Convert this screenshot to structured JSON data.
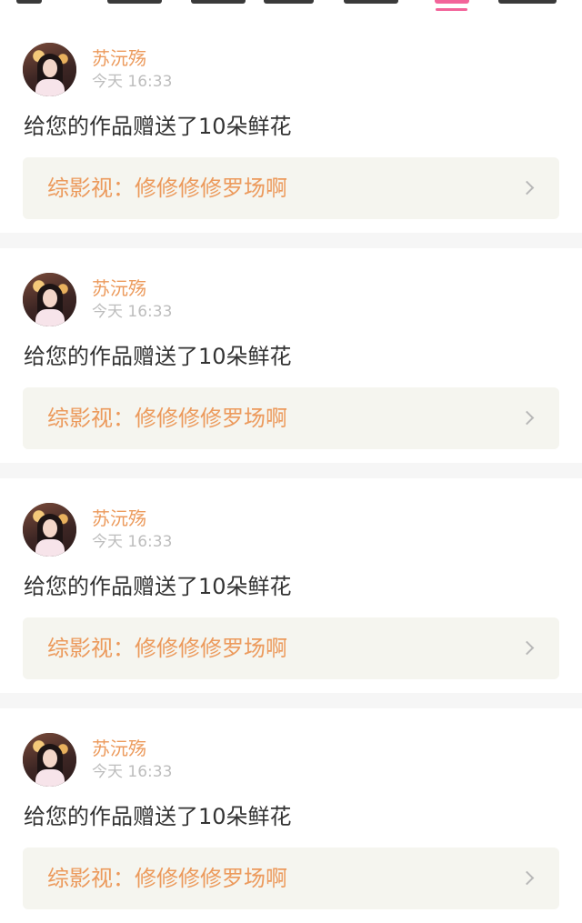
{
  "tabs": {
    "active_index": 5,
    "accent_color": "#f2649a"
  },
  "colors": {
    "name_accent": "#ec9a5c",
    "timestamp": "#bdbdbd",
    "message": "#333333",
    "link_bg": "#f5f5ef"
  },
  "notifications": [
    {
      "username": "苏沅殇",
      "time": "今天 16:33",
      "message": "给您的作品赠送了10朵鲜花",
      "work_title": "综影视：修修修修罗场啊",
      "icon": "chevron-right-icon"
    },
    {
      "username": "苏沅殇",
      "time": "今天 16:33",
      "message": "给您的作品赠送了10朵鲜花",
      "work_title": "综影视：修修修修罗场啊",
      "icon": "chevron-right-icon"
    },
    {
      "username": "苏沅殇",
      "time": "今天 16:33",
      "message": "给您的作品赠送了10朵鲜花",
      "work_title": "综影视：修修修修罗场啊",
      "icon": "chevron-right-icon"
    },
    {
      "username": "苏沅殇",
      "time": "今天 16:33",
      "message": "给您的作品赠送了10朵鲜花",
      "work_title": "综影视：修修修修罗场啊",
      "icon": "chevron-right-icon"
    }
  ]
}
